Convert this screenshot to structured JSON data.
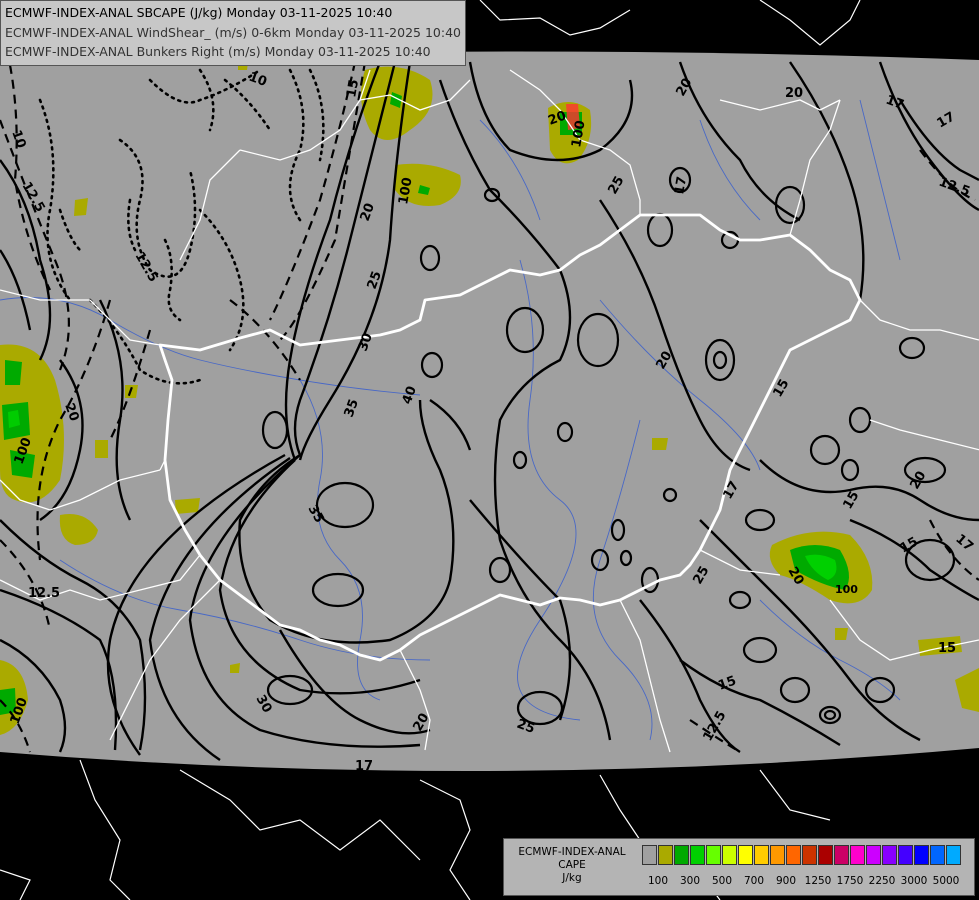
{
  "header": {
    "lines": [
      "ECMWF-INDEX-ANAL SBCAPE (J/kg) Monday 03-11-2025 10:40",
      "ECMWF-INDEX-ANAL WindShear_ (m/s) 0-6km Monday 03-11-2025 10:40",
      "ECMWF-INDEX-ANAL Bunkers Right (m/s) Monday 03-11-2025 10:40"
    ]
  },
  "legend": {
    "title_line1": "ECMWF-INDEX-ANAL",
    "title_line2": "CAPE",
    "title_line3": "J/kg",
    "swatch_colors": [
      "#a0a0a0",
      "#aaaa00",
      "#00aa00",
      "#00d000",
      "#66ff00",
      "#ccff00",
      "#ffff00",
      "#ffcc00",
      "#ff9900",
      "#ff6600",
      "#cc3300",
      "#aa0000",
      "#cc0066",
      "#ff00cc",
      "#cc00ff",
      "#8800ff",
      "#4400ff",
      "#0000ff",
      "#0066ff",
      "#00aaff",
      "#00ffff",
      "#88ffff",
      "#ffffff"
    ],
    "tick_labels": [
      "100",
      "300",
      "500",
      "700",
      "900",
      "1250",
      "1750",
      "2250",
      "3000",
      "5000"
    ]
  },
  "contour_labels": [
    {
      "text": "10"
    },
    {
      "text": "10"
    },
    {
      "text": "12.5"
    },
    {
      "text": "12.5"
    },
    {
      "text": "20"
    },
    {
      "text": "20"
    },
    {
      "text": "20"
    },
    {
      "text": "20"
    },
    {
      "text": "25"
    },
    {
      "text": "25"
    },
    {
      "text": "30"
    },
    {
      "text": "35"
    },
    {
      "text": "40"
    },
    {
      "text": "35"
    },
    {
      "text": "30"
    },
    {
      "text": "20"
    },
    {
      "text": "25"
    },
    {
      "text": "17"
    },
    {
      "text": "17"
    },
    {
      "text": "12.5"
    },
    {
      "text": "17"
    },
    {
      "text": "15"
    },
    {
      "text": "20"
    },
    {
      "text": "15"
    },
    {
      "text": "17"
    },
    {
      "text": "15"
    },
    {
      "text": "20"
    },
    {
      "text": "17"
    },
    {
      "text": "25"
    },
    {
      "text": "15"
    },
    {
      "text": "12.5"
    },
    {
      "text": "15"
    },
    {
      "text": "12.5"
    },
    {
      "text": "17"
    },
    {
      "text": "100"
    },
    {
      "text": "100"
    },
    {
      "text": "100"
    },
    {
      "text": "100"
    },
    {
      "text": "100"
    },
    {
      "text": "20"
    },
    {
      "text": "20"
    },
    {
      "text": "15"
    }
  ],
  "colors": {
    "background": "#000000",
    "domain": "#a0a0a0",
    "contour": "#000000",
    "border": "#ffffff",
    "river": "#3a5fcd",
    "cape_low": "#aaaa00",
    "cape_mid": "#00aa00",
    "cape_high": "#00d000"
  }
}
